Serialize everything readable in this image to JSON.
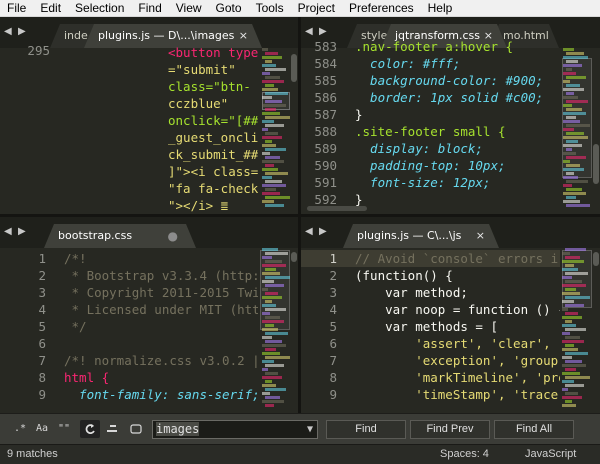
{
  "menu": [
    "File",
    "Edit",
    "Selection",
    "Find",
    "View",
    "Goto",
    "Tools",
    "Project",
    "Preferences",
    "Help"
  ],
  "panes": {
    "top_left": {
      "tabs": [
        {
          "label": "inde",
          "state": "dim"
        },
        {
          "label": "plugins.js — D\\...\\images",
          "state": "active",
          "close": "×"
        }
      ],
      "gutter": [
        "295"
      ],
      "lines": [
        "<button type",
        "=\"submit\"",
        "class=\"btn-",
        "cczblue\"",
        "onclick=\"[##",
        "_guest_oncli",
        "ck_submit_##",
        "]\"><i class=",
        "\"fa fa-check",
        "\"></i> ≣"
      ]
    },
    "top_right": {
      "tabs": [
        {
          "label": "style",
          "state": "dim"
        },
        {
          "label": "jqtransform.css",
          "state": "active",
          "close": "×"
        },
        {
          "label": "mo.html",
          "state": "dim"
        }
      ],
      "gutter": [
        "583",
        "584",
        "585",
        "586",
        "587",
        "588",
        "589",
        "590",
        "591",
        "592"
      ],
      "lines": [
        ".nav-footer a:hover {",
        "  color: #fff;",
        "  background-color: #900;",
        "  border: 1px solid #c00;",
        "}",
        ".site-footer small {",
        "  display: block;",
        "  padding-top: 10px;",
        "  font-size: 12px;",
        "}"
      ]
    },
    "bottom_left": {
      "tabs": [
        {
          "label": "bootstrap.css",
          "state": "active",
          "dot": "●"
        }
      ],
      "gutter": [
        "1",
        "2",
        "3",
        "4",
        "5",
        "6",
        "7",
        "8",
        "9"
      ],
      "lines": [
        "/*!",
        " * Bootstrap v3.3.4 (http:",
        " * Copyright 2011-2015 Twi",
        " * Licensed under MIT (htt",
        " */",
        "",
        "/*! normalize.css v3.0.2 |",
        "html {",
        "  font-family: sans-serif;"
      ]
    },
    "bottom_right": {
      "tabs": [
        {
          "label": "plugins.js — C\\...\\js",
          "state": "active",
          "close": "×"
        }
      ],
      "gutter": [
        "1",
        "2",
        "3",
        "4",
        "5",
        "6",
        "7",
        "8",
        "9"
      ],
      "lines": [
        "// Avoid `console` errors i",
        "(function() {",
        "    var method;",
        "    var noop = function () {",
        "    var methods = [",
        "        'assert', 'clear', ",
        "        'exception', 'group",
        "        'markTimeline', 'pro",
        "        'timeStamp', 'trace"
      ]
    }
  },
  "find": {
    "regex_icon": ".*",
    "case_icon": "Aa",
    "word_icon": "\"\"",
    "query": "images",
    "find_label": "Find",
    "find_prev_label": "Find Prev",
    "find_all_label": "Find All"
  },
  "status": {
    "matches": "9 matches",
    "spaces": "Spaces: 4",
    "syntax": "JavaScript"
  }
}
